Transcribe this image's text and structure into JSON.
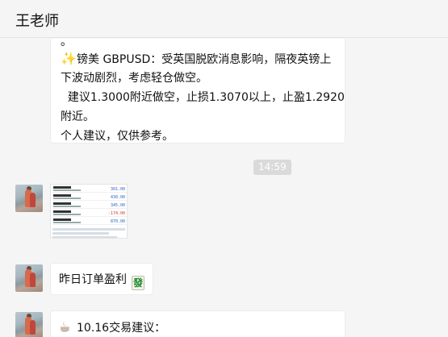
{
  "header": {
    "title": "王老师"
  },
  "messages": {
    "m1": {
      "lines": [
        "。",
        "镑美 GBPUSD：受英国脱欧消息影响，隔夜英镑上",
        "下波动剧烈，考虑轻仓做空。",
        "  建议1.3000附近做空，止损1.3070以上，止盈1.2920",
        "附近。",
        "个人建议，仅供参考。"
      ],
      "emoji": "sparkles-emoji"
    },
    "timestamp": "14:59",
    "screenshot": {
      "values": [
        "301.00",
        "430.00",
        "345.00",
        "-174.00",
        "870.00"
      ]
    },
    "m2": {
      "text": "昨日订单盈利",
      "tile": "發",
      "emoji": "fa-mahjong-tile-emoji"
    },
    "m3": {
      "text": "10.16交易建议：",
      "emoji": "hot-beverage-emoji"
    }
  }
}
